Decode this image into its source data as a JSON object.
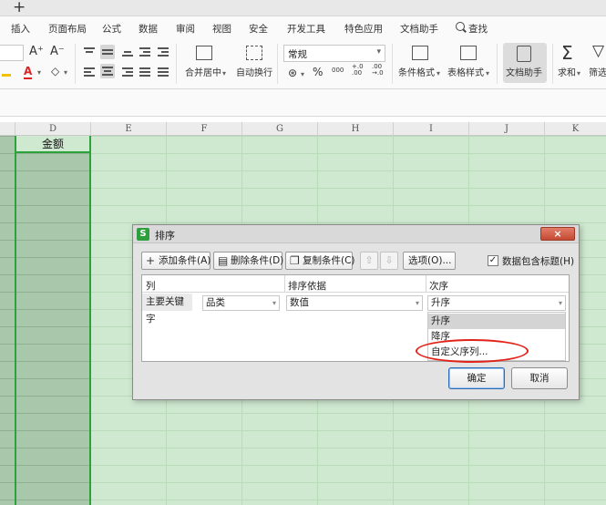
{
  "window": {
    "new_tab_label": "+"
  },
  "ribbon_menu": {
    "items": [
      "插入",
      "页面布局",
      "公式",
      "数据",
      "审阅",
      "视图",
      "安全",
      "开发工具",
      "特色应用",
      "文档助手"
    ],
    "search_label": "查找"
  },
  "toolbar": {
    "font_grow": "A⁺",
    "font_shrink": "A⁻",
    "merge_center": "合并居中",
    "wrap_text": "自动换行",
    "number_format": "常规",
    "percent": "%",
    "thousands": "000",
    "dec_increase": "+.0\n.00",
    "conditional_format": "条件格式",
    "table_style": "表格样式",
    "doc_assistant": "文档助手",
    "sum": "求和",
    "filter": "筛选"
  },
  "sheet": {
    "columns": [
      "D",
      "E",
      "F",
      "G",
      "H",
      "I",
      "J",
      "K"
    ],
    "d1_value": "金额"
  },
  "dialog": {
    "title": "排序",
    "close": "×",
    "buttons": {
      "add_condition": "添加条件(A)",
      "delete_condition": "删除条件(D)",
      "copy_condition": "复制条件(C)",
      "move_up": "⇧",
      "move_down": "⇩",
      "options": "选项(O)..."
    },
    "header_checkbox": {
      "label": "数据包含标题(H)",
      "checked": true,
      "mark": "✓"
    },
    "table": {
      "headers": {
        "column": "列",
        "sort_by": "排序依据",
        "order": "次序"
      },
      "row": {
        "label": "主要关键字",
        "column_value": "品类",
        "sort_by_value": "数值",
        "order_value": "升序"
      },
      "order_options": [
        "升序",
        "降序",
        "自定义序列..."
      ]
    },
    "ok": "确定",
    "cancel": "取消"
  },
  "colors": {
    "accent_green": "#2da23a",
    "annotation_red": "#e2231a"
  }
}
